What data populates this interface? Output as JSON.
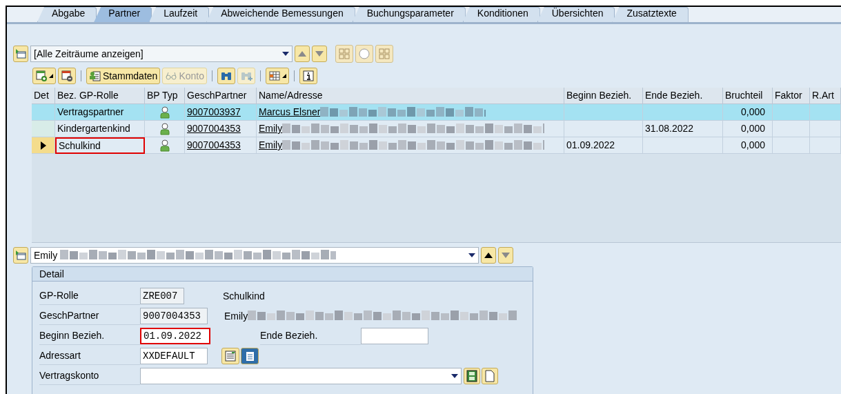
{
  "tabs": [
    {
      "label": "Abgabe",
      "selected": false
    },
    {
      "label": "Partner",
      "selected": true
    },
    {
      "label": "Laufzeit",
      "selected": false
    },
    {
      "label": "Abweichende Bemessungen",
      "selected": false
    },
    {
      "label": "Buchungsparameter",
      "selected": false
    },
    {
      "label": "Konditionen",
      "selected": false
    },
    {
      "label": "Übersichten",
      "selected": false
    },
    {
      "label": "Zusatztexte",
      "selected": false
    }
  ],
  "period_selector": {
    "value": "[Alle Zeiträume anzeigen]"
  },
  "toolbar": [
    {
      "kind": "icon",
      "dropdown": true,
      "disabled": false
    },
    {
      "kind": "icon",
      "dropdown": false,
      "disabled": false
    },
    {
      "kind": "sep"
    },
    {
      "kind": "text",
      "label": "Stammdaten",
      "disabled": false
    },
    {
      "kind": "text",
      "label": "Konto",
      "disabled": true
    },
    {
      "kind": "sep"
    },
    {
      "kind": "icon",
      "dropdown": false,
      "disabled": false
    },
    {
      "kind": "icon",
      "dropdown": false,
      "disabled": true
    },
    {
      "kind": "sep"
    },
    {
      "kind": "icon",
      "dropdown": true,
      "disabled": false
    },
    {
      "kind": "sep"
    },
    {
      "kind": "icon",
      "dropdown": false,
      "disabled": false
    }
  ],
  "table": {
    "columns": [
      "Det",
      "Bez. GP-Rolle",
      "BP Typ",
      "GeschPartner",
      "Name/Adresse",
      "Beginn Bezieh.",
      "Ende Bezieh.",
      "Bruchteil",
      "Faktor",
      "R.Art"
    ],
    "rows": [
      {
        "selected": true,
        "current": false,
        "marked": false,
        "role": "Vertragspartner",
        "partner": "9007003937",
        "name": "Marcus Elsner",
        "begin": "",
        "end": "",
        "fraction": "0,000"
      },
      {
        "selected": false,
        "current": false,
        "marked": false,
        "role": "Kindergartenkind",
        "partner": "9007004353",
        "name": "Emily",
        "begin": "",
        "end": "31.08.2022",
        "fraction": "0,000"
      },
      {
        "selected": false,
        "current": true,
        "marked": true,
        "role": "Schulkind",
        "partner": "9007004353",
        "name": "Emily",
        "begin": "01.09.2022",
        "end": "",
        "fraction": "0,000"
      }
    ]
  },
  "partner_selector": {
    "value": "Emily"
  },
  "detail": {
    "title": "Detail",
    "gp_role": {
      "label": "GP-Rolle",
      "value": "ZRE007",
      "text": "Schulkind"
    },
    "partner": {
      "label": "GeschPartner",
      "value": "9007004353",
      "text": "Emily"
    },
    "begin": {
      "label": "Beginn Bezieh.",
      "value": "01.09.2022",
      "marked": true
    },
    "end": {
      "label": "Ende Bezieh."
    },
    "address_type": {
      "label": "Adressart",
      "value": "XXDEFAULT"
    },
    "account": {
      "label": "Vertragskonto"
    }
  }
}
